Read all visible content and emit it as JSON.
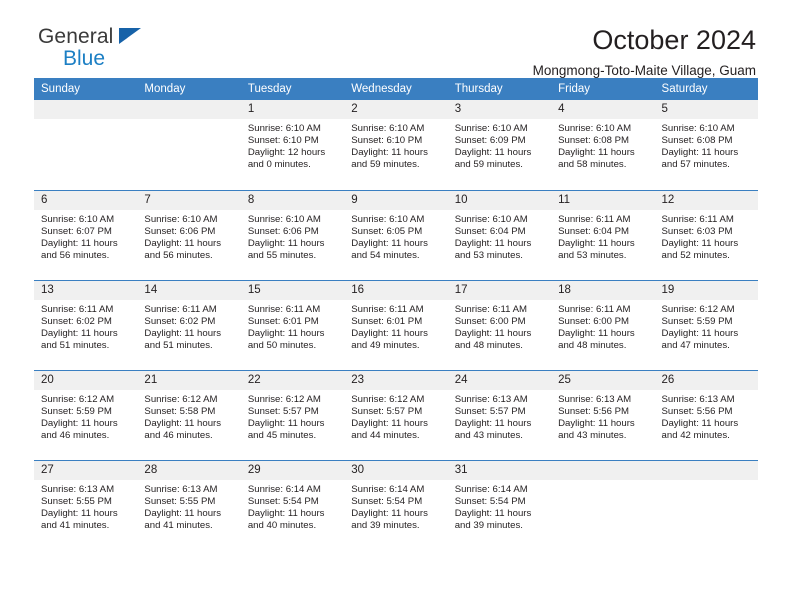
{
  "brand": {
    "name_top": "General",
    "name_bottom": "Blue",
    "accent_color": "#1c7fc4",
    "triangle_color": "#1762a8"
  },
  "header": {
    "title": "October 2024",
    "subtitle": "Mongmong-Toto-Maite Village, Guam"
  },
  "calendar": {
    "header_bg": "#3a7fc1",
    "header_text_color": "#ffffff",
    "daynum_bg": "#f0f0f0",
    "weekday_names": [
      "Sunday",
      "Monday",
      "Tuesday",
      "Wednesday",
      "Thursday",
      "Friday",
      "Saturday"
    ],
    "labels": {
      "sunrise": "Sunrise:",
      "sunset": "Sunset:",
      "daylight": "Daylight:"
    },
    "weeks": [
      [
        {
          "day": "",
          "empty": true
        },
        {
          "day": "",
          "empty": true
        },
        {
          "day": "1",
          "sunrise": "Sunrise: 6:10 AM",
          "sunset": "Sunset: 6:10 PM",
          "daylight_1": "Daylight: 12 hours",
          "daylight_2": "and 0 minutes."
        },
        {
          "day": "2",
          "sunrise": "Sunrise: 6:10 AM",
          "sunset": "Sunset: 6:10 PM",
          "daylight_1": "Daylight: 11 hours",
          "daylight_2": "and 59 minutes."
        },
        {
          "day": "3",
          "sunrise": "Sunrise: 6:10 AM",
          "sunset": "Sunset: 6:09 PM",
          "daylight_1": "Daylight: 11 hours",
          "daylight_2": "and 59 minutes."
        },
        {
          "day": "4",
          "sunrise": "Sunrise: 6:10 AM",
          "sunset": "Sunset: 6:08 PM",
          "daylight_1": "Daylight: 11 hours",
          "daylight_2": "and 58 minutes."
        },
        {
          "day": "5",
          "sunrise": "Sunrise: 6:10 AM",
          "sunset": "Sunset: 6:08 PM",
          "daylight_1": "Daylight: 11 hours",
          "daylight_2": "and 57 minutes."
        }
      ],
      [
        {
          "day": "6",
          "sunrise": "Sunrise: 6:10 AM",
          "sunset": "Sunset: 6:07 PM",
          "daylight_1": "Daylight: 11 hours",
          "daylight_2": "and 56 minutes."
        },
        {
          "day": "7",
          "sunrise": "Sunrise: 6:10 AM",
          "sunset": "Sunset: 6:06 PM",
          "daylight_1": "Daylight: 11 hours",
          "daylight_2": "and 56 minutes."
        },
        {
          "day": "8",
          "sunrise": "Sunrise: 6:10 AM",
          "sunset": "Sunset: 6:06 PM",
          "daylight_1": "Daylight: 11 hours",
          "daylight_2": "and 55 minutes."
        },
        {
          "day": "9",
          "sunrise": "Sunrise: 6:10 AM",
          "sunset": "Sunset: 6:05 PM",
          "daylight_1": "Daylight: 11 hours",
          "daylight_2": "and 54 minutes."
        },
        {
          "day": "10",
          "sunrise": "Sunrise: 6:10 AM",
          "sunset": "Sunset: 6:04 PM",
          "daylight_1": "Daylight: 11 hours",
          "daylight_2": "and 53 minutes."
        },
        {
          "day": "11",
          "sunrise": "Sunrise: 6:11 AM",
          "sunset": "Sunset: 6:04 PM",
          "daylight_1": "Daylight: 11 hours",
          "daylight_2": "and 53 minutes."
        },
        {
          "day": "12",
          "sunrise": "Sunrise: 6:11 AM",
          "sunset": "Sunset: 6:03 PM",
          "daylight_1": "Daylight: 11 hours",
          "daylight_2": "and 52 minutes."
        }
      ],
      [
        {
          "day": "13",
          "sunrise": "Sunrise: 6:11 AM",
          "sunset": "Sunset: 6:02 PM",
          "daylight_1": "Daylight: 11 hours",
          "daylight_2": "and 51 minutes."
        },
        {
          "day": "14",
          "sunrise": "Sunrise: 6:11 AM",
          "sunset": "Sunset: 6:02 PM",
          "daylight_1": "Daylight: 11 hours",
          "daylight_2": "and 51 minutes."
        },
        {
          "day": "15",
          "sunrise": "Sunrise: 6:11 AM",
          "sunset": "Sunset: 6:01 PM",
          "daylight_1": "Daylight: 11 hours",
          "daylight_2": "and 50 minutes."
        },
        {
          "day": "16",
          "sunrise": "Sunrise: 6:11 AM",
          "sunset": "Sunset: 6:01 PM",
          "daylight_1": "Daylight: 11 hours",
          "daylight_2": "and 49 minutes."
        },
        {
          "day": "17",
          "sunrise": "Sunrise: 6:11 AM",
          "sunset": "Sunset: 6:00 PM",
          "daylight_1": "Daylight: 11 hours",
          "daylight_2": "and 48 minutes."
        },
        {
          "day": "18",
          "sunrise": "Sunrise: 6:11 AM",
          "sunset": "Sunset: 6:00 PM",
          "daylight_1": "Daylight: 11 hours",
          "daylight_2": "and 48 minutes."
        },
        {
          "day": "19",
          "sunrise": "Sunrise: 6:12 AM",
          "sunset": "Sunset: 5:59 PM",
          "daylight_1": "Daylight: 11 hours",
          "daylight_2": "and 47 minutes."
        }
      ],
      [
        {
          "day": "20",
          "sunrise": "Sunrise: 6:12 AM",
          "sunset": "Sunset: 5:59 PM",
          "daylight_1": "Daylight: 11 hours",
          "daylight_2": "and 46 minutes."
        },
        {
          "day": "21",
          "sunrise": "Sunrise: 6:12 AM",
          "sunset": "Sunset: 5:58 PM",
          "daylight_1": "Daylight: 11 hours",
          "daylight_2": "and 46 minutes."
        },
        {
          "day": "22",
          "sunrise": "Sunrise: 6:12 AM",
          "sunset": "Sunset: 5:57 PM",
          "daylight_1": "Daylight: 11 hours",
          "daylight_2": "and 45 minutes."
        },
        {
          "day": "23",
          "sunrise": "Sunrise: 6:12 AM",
          "sunset": "Sunset: 5:57 PM",
          "daylight_1": "Daylight: 11 hours",
          "daylight_2": "and 44 minutes."
        },
        {
          "day": "24",
          "sunrise": "Sunrise: 6:13 AM",
          "sunset": "Sunset: 5:57 PM",
          "daylight_1": "Daylight: 11 hours",
          "daylight_2": "and 43 minutes."
        },
        {
          "day": "25",
          "sunrise": "Sunrise: 6:13 AM",
          "sunset": "Sunset: 5:56 PM",
          "daylight_1": "Daylight: 11 hours",
          "daylight_2": "and 43 minutes."
        },
        {
          "day": "26",
          "sunrise": "Sunrise: 6:13 AM",
          "sunset": "Sunset: 5:56 PM",
          "daylight_1": "Daylight: 11 hours",
          "daylight_2": "and 42 minutes."
        }
      ],
      [
        {
          "day": "27",
          "sunrise": "Sunrise: 6:13 AM",
          "sunset": "Sunset: 5:55 PM",
          "daylight_1": "Daylight: 11 hours",
          "daylight_2": "and 41 minutes."
        },
        {
          "day": "28",
          "sunrise": "Sunrise: 6:13 AM",
          "sunset": "Sunset: 5:55 PM",
          "daylight_1": "Daylight: 11 hours",
          "daylight_2": "and 41 minutes."
        },
        {
          "day": "29",
          "sunrise": "Sunrise: 6:14 AM",
          "sunset": "Sunset: 5:54 PM",
          "daylight_1": "Daylight: 11 hours",
          "daylight_2": "and 40 minutes."
        },
        {
          "day": "30",
          "sunrise": "Sunrise: 6:14 AM",
          "sunset": "Sunset: 5:54 PM",
          "daylight_1": "Daylight: 11 hours",
          "daylight_2": "and 39 minutes."
        },
        {
          "day": "31",
          "sunrise": "Sunrise: 6:14 AM",
          "sunset": "Sunset: 5:54 PM",
          "daylight_1": "Daylight: 11 hours",
          "daylight_2": "and 39 minutes."
        },
        {
          "day": "",
          "empty": true
        },
        {
          "day": "",
          "empty": true
        }
      ]
    ]
  }
}
